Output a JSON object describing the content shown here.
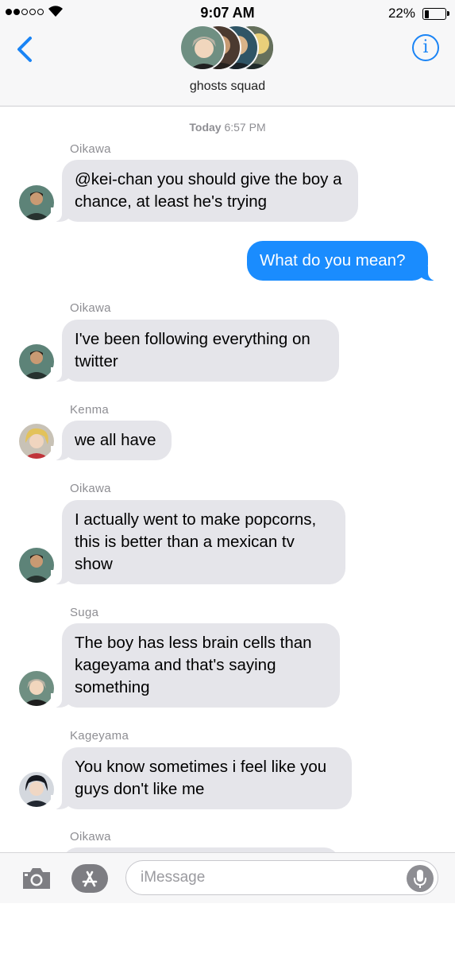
{
  "status_bar": {
    "time": "9:07 AM",
    "battery_percent": "22%",
    "battery_level": 0.22,
    "signal_bars_filled": 2,
    "signal_bars_total": 5
  },
  "header": {
    "group_name": "ghosts squad",
    "back_icon": "chevron-left-icon",
    "info_icon": "info-icon"
  },
  "thread": {
    "timestamp_day": "Today",
    "timestamp_time": "6:57 PM",
    "messages": [
      {
        "sender": "Oikawa",
        "text": "@kei-chan you should give the boy a chance, at least he's trying",
        "direction": "incoming"
      },
      {
        "sender": "",
        "text": "What do you mean?",
        "direction": "outgoing"
      },
      {
        "sender": "Oikawa",
        "text": "I've been following everything on twitter",
        "direction": "incoming"
      },
      {
        "sender": "Kenma",
        "text": "we all have",
        "direction": "incoming"
      },
      {
        "sender": "Oikawa",
        "text": "I actually went to make popcorns, this is better than a mexican tv show",
        "direction": "incoming"
      },
      {
        "sender": "Suga",
        "text": "The boy has less brain cells than kageyama and that's saying something",
        "direction": "incoming"
      },
      {
        "sender": "Kageyama",
        "text": "You know sometimes i feel like you guys don't like me",
        "direction": "incoming"
      },
      {
        "sender": "Oikawa",
        "text": "",
        "direction": "incoming"
      }
    ]
  },
  "input_bar": {
    "placeholder": "iMessage",
    "camera_icon": "camera-icon",
    "apps_icon": "app-store-icon",
    "mic_icon": "microphone-icon"
  },
  "colors": {
    "outgoing_bubble": "#1a8cfe",
    "incoming_bubble": "#e5e5ea",
    "accent": "#1a84f5",
    "meta_text": "#8e8e93"
  }
}
